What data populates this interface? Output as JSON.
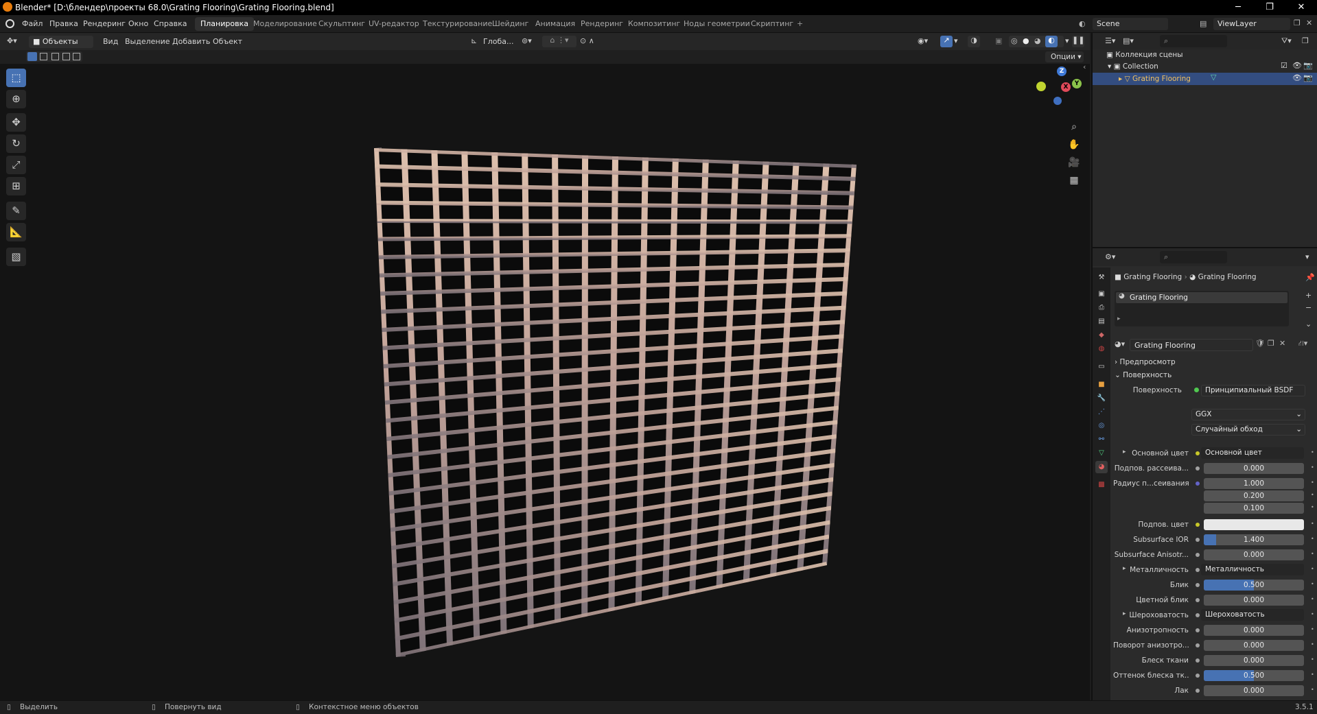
{
  "titlebar": {
    "title": "Blender* [D:\\блендер\\проекты 68.0\\Grating Flooring\\Grating Flooring.blend]",
    "minimize": "─",
    "maximize": "❐",
    "close": "✕"
  },
  "menus": [
    "Файл",
    "Правка",
    "Рендеринг",
    "Окно",
    "Справка"
  ],
  "workspaces": [
    "Планировка",
    "Моделирование",
    "Скульптинг",
    "UV-редактор",
    "Текстурирование",
    "Шейдинг",
    "Анимация",
    "Рендеринг",
    "Композитинг",
    "Ноды геометрии",
    "Скриптинг"
  ],
  "workspace_add": "+",
  "scene": {
    "label": "Scene",
    "view_layer": "ViewLayer"
  },
  "viewport_header": {
    "mode": "Объекты",
    "menus": [
      "Вид",
      "Выделение",
      "Добавить",
      "Объект"
    ],
    "transform_orientation": "Глоба...",
    "options": "Опции"
  },
  "toolbar_tools": [
    "select-box",
    "cursor",
    "move",
    "rotate",
    "scale",
    "transform",
    "annotate",
    "measure",
    "add-cube"
  ],
  "gizmo": {
    "x": "X",
    "y": "Y",
    "z": "Z"
  },
  "outliner": {
    "scene_collection": "Коллекция сцены",
    "collection": "Collection",
    "object": "Grating Flooring"
  },
  "properties": {
    "breadcrumb_object": "Grating Flooring",
    "breadcrumb_material": "Grating Flooring",
    "slot": "Grating Flooring",
    "material_name": "Grating Flooring",
    "panel_preview": "Предпросмотр",
    "panel_surface": "Поверхность",
    "surface_label": "Поверхность",
    "surface_value": "Принципиальный BSDF",
    "distribution": "GGX",
    "subsurface_method": "Случайный обход",
    "rows": [
      {
        "label": "Основной цвет",
        "value": "Основной цвет",
        "kind": "link",
        "dot": "#c7c729",
        "expand": true
      },
      {
        "label": "Подпов. рассеива...",
        "value": "0.000",
        "kind": "num",
        "dot": "#a1a1a1",
        "fill": 0
      },
      {
        "label": "Радиус п...сеивания",
        "value": "1.000",
        "kind": "num",
        "dot": "#6363c7",
        "fill": 0
      },
      {
        "label": "",
        "value": "0.200",
        "kind": "num",
        "dot": "",
        "fill": 0
      },
      {
        "label": "",
        "value": "0.100",
        "kind": "num",
        "dot": "",
        "fill": 0
      },
      {
        "label": "Подпов. цвет",
        "value": "",
        "kind": "color",
        "dot": "#c7c729",
        "color": "#e8e8e8"
      },
      {
        "label": "Subsurface IOR",
        "value": "1.400",
        "kind": "num",
        "dot": "#a1a1a1",
        "fill": 0.12
      },
      {
        "label": "Subsurface Anisotr...",
        "value": "0.000",
        "kind": "num",
        "dot": "#a1a1a1",
        "fill": 0
      },
      {
        "label": "Металличность",
        "value": "Металличность",
        "kind": "link",
        "dot": "#a1a1a1",
        "expand": true
      },
      {
        "label": "Блик",
        "value": "0.500",
        "kind": "num",
        "dot": "#a1a1a1",
        "fill": 0.5
      },
      {
        "label": "Цветной блик",
        "value": "0.000",
        "kind": "num",
        "dot": "#a1a1a1",
        "fill": 0
      },
      {
        "label": "Шероховатость",
        "value": "Шероховатость",
        "kind": "link",
        "dot": "#a1a1a1",
        "expand": true
      },
      {
        "label": "Анизотропность",
        "value": "0.000",
        "kind": "num",
        "dot": "#a1a1a1",
        "fill": 0
      },
      {
        "label": "Поворот анизотро...",
        "value": "0.000",
        "kind": "num",
        "dot": "#a1a1a1",
        "fill": 0
      },
      {
        "label": "Блеск ткани",
        "value": "0.000",
        "kind": "num",
        "dot": "#a1a1a1",
        "fill": 0
      },
      {
        "label": "Оттенок блеска тк...",
        "value": "0.500",
        "kind": "num",
        "dot": "#a1a1a1",
        "fill": 0.5
      },
      {
        "label": "Лак",
        "value": "0.000",
        "kind": "num",
        "dot": "#a1a1a1",
        "fill": 0
      }
    ]
  },
  "statusbar": {
    "select": "Выделить",
    "rotate": "Повернуть вид",
    "context": "Контекстное меню объектов",
    "version": "3.5.1"
  },
  "colors": {
    "accent": "#4772b3",
    "grating_light": "#d9b8a2",
    "grating_dark": "#8a7d80"
  }
}
